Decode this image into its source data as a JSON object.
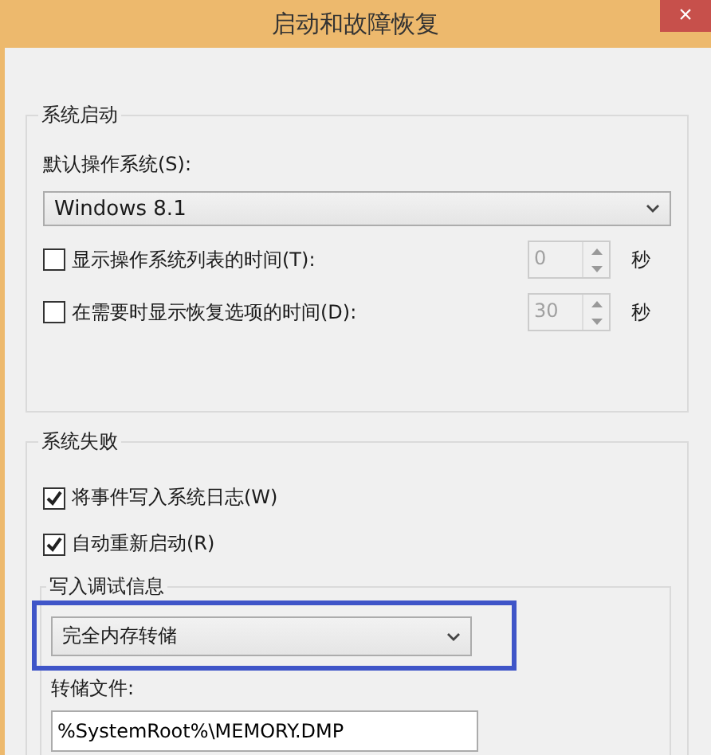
{
  "window": {
    "title": "启动和故障恢复",
    "close": "×"
  },
  "startup": {
    "legend": "系统启动",
    "default_os_label": "默认操作系统(S):",
    "default_os": "Windows 8.1",
    "timers": [
      {
        "label": "显示操作系统列表的时间(T):",
        "checked": false,
        "value": "0",
        "disabled": true,
        "unit": "秒"
      },
      {
        "label": "在需要时显示恢复选项的时间(D):",
        "checked": false,
        "value": "30",
        "disabled": true,
        "unit": "秒"
      }
    ]
  },
  "failure": {
    "legend": "系统失败",
    "options": [
      {
        "label": "将事件写入系统日志(W)",
        "checked": true
      },
      {
        "label": "自动重新启动(R)",
        "checked": true
      }
    ],
    "debug": {
      "legend": "写入调试信息",
      "value": "完全内存转储",
      "highlighted": true,
      "dump_label": "转储文件:",
      "dump_file": "%SystemRoot%\\MEMORY.DMP"
    }
  }
}
